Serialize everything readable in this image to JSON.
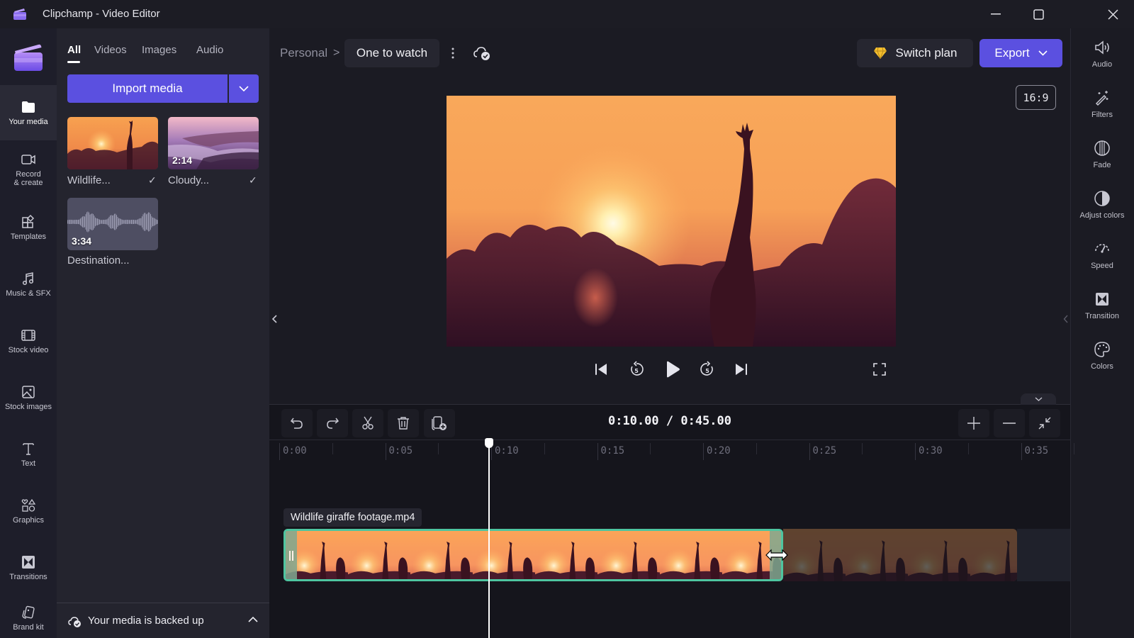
{
  "window": {
    "title": "Clipchamp - Video Editor",
    "controls": {
      "minimize": "minimize",
      "maximize": "maximize",
      "close": "close"
    }
  },
  "left_nav": {
    "items": [
      {
        "label": "Your media",
        "icon": "folder-icon",
        "active": true
      },
      {
        "label": "Record\n& create",
        "icon": "camera-icon",
        "active": false
      },
      {
        "label": "Templates",
        "icon": "templates-icon",
        "active": false
      },
      {
        "label": "Music & SFX",
        "icon": "music-icon",
        "active": false
      },
      {
        "label": "Stock video",
        "icon": "film-icon",
        "active": false
      },
      {
        "label": "Stock images",
        "icon": "image-icon",
        "active": false
      },
      {
        "label": "Text",
        "icon": "text-icon",
        "active": false
      },
      {
        "label": "Graphics",
        "icon": "shapes-icon",
        "active": false
      },
      {
        "label": "Transitions",
        "icon": "transition-icon",
        "active": false
      },
      {
        "label": "Brand kit",
        "icon": "brand-kit-icon",
        "active": false
      }
    ]
  },
  "media_panel": {
    "tabs": [
      {
        "label": "All",
        "active": true
      },
      {
        "label": "Videos",
        "active": false
      },
      {
        "label": "Images",
        "active": false
      },
      {
        "label": "Audio",
        "active": false
      }
    ],
    "import_label": "Import media",
    "items": [
      {
        "label": "Wildlife...",
        "duration": "",
        "type": "video",
        "added": true
      },
      {
        "label": "Cloudy...",
        "duration": "2:14",
        "type": "video",
        "added": true
      },
      {
        "label": "Destination...",
        "duration": "3:34",
        "type": "audio",
        "added": false
      }
    ],
    "backup_status": "Your media is backed up"
  },
  "header": {
    "breadcrumb_parent": "Personal",
    "breadcrumb_separator": ">",
    "project_name": "One to watch",
    "switch_plan_label": "Switch plan",
    "export_label": "Export",
    "aspect_ratio": "16:9",
    "accent_color": "#5b50e0",
    "plan_icon_color": "#f5c02e"
  },
  "playback": {
    "buttons": [
      "skip-to-start",
      "rewind-5s",
      "play",
      "forward-5s",
      "skip-to-end",
      "fullscreen"
    ],
    "skip_seconds": "5"
  },
  "right_rail": {
    "items": [
      {
        "label": "Audio",
        "icon": "speaker-icon"
      },
      {
        "label": "Filters",
        "icon": "magic-wand-icon"
      },
      {
        "label": "Fade",
        "icon": "fade-icon"
      },
      {
        "label": "Adjust colors",
        "icon": "contrast-icon"
      },
      {
        "label": "Speed",
        "icon": "speedometer-icon"
      },
      {
        "label": "Transition",
        "icon": "transition-icon"
      },
      {
        "label": "Colors",
        "icon": "palette-icon"
      }
    ]
  },
  "timeline": {
    "current_time": "0:10.00",
    "total_time": "0:45.00",
    "timecode_display": "0:10.00 / 0:45.00",
    "ruler_labels": [
      "0:00",
      "0:05",
      "0:10",
      "0:15",
      "0:20",
      "0:25",
      "0:30",
      "0:35"
    ],
    "clip_name": "Wildlife giraffe footage.mp4",
    "clip_color": "#4ec5a0",
    "tools": [
      "undo",
      "redo",
      "split",
      "delete",
      "add-to-timeline"
    ],
    "zoom_tools": [
      "zoom-in",
      "zoom-out",
      "fit"
    ]
  }
}
